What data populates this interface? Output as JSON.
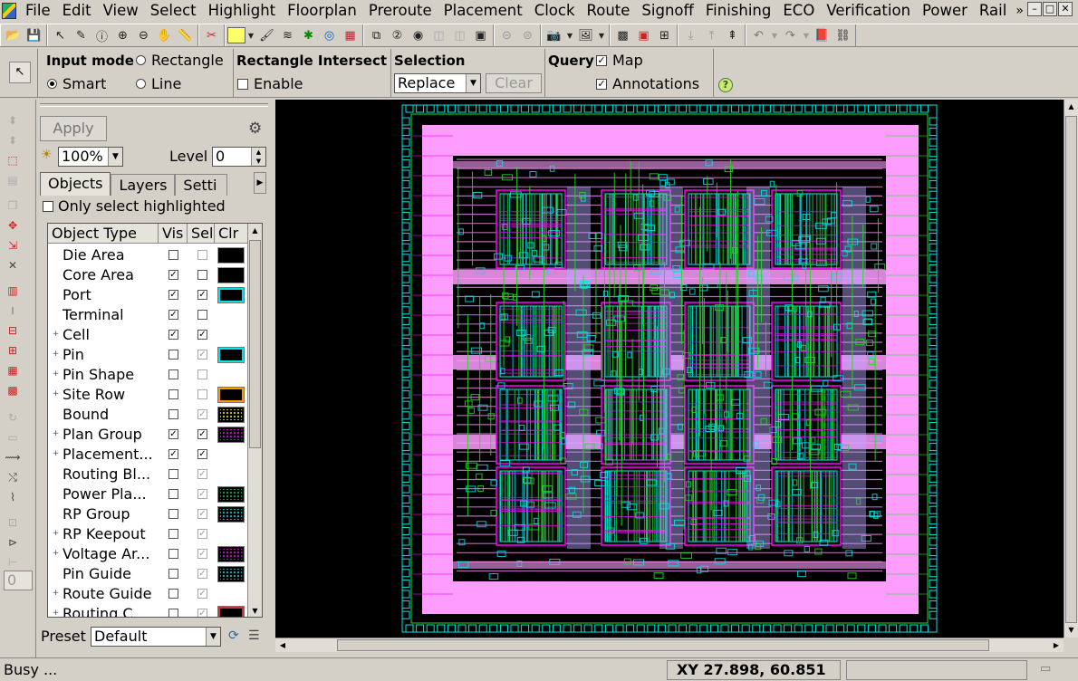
{
  "menu": [
    "File",
    "Edit",
    "View",
    "Select",
    "Highlight",
    "Floorplan",
    "Preroute",
    "Placement",
    "Clock",
    "Route",
    "Signoff",
    "Finishing",
    "ECO",
    "Verification",
    "Power",
    "Rail"
  ],
  "menu_overflow": "»",
  "window_controls": [
    "–",
    "□",
    "✕"
  ],
  "options": {
    "input_mode": {
      "label": "Input mode",
      "rectangle": "Rectangle",
      "smart": "Smart",
      "line": "Line",
      "selected": "Smart"
    },
    "rect_intersect": {
      "label": "Rectangle Intersect",
      "enable": "Enable",
      "enabled": false
    },
    "selection": {
      "label": "Selection",
      "value": "Replace",
      "clear_label": "Clear"
    },
    "query": {
      "label": "Query",
      "map": "Map",
      "map_checked": true,
      "annotations": "Annotations",
      "annotations_checked": true
    },
    "help_glyph": "?"
  },
  "panel": {
    "apply_label": "Apply",
    "brightness": "100%",
    "level_label": "Level",
    "level_value": "0",
    "tabs": [
      "Objects",
      "Layers",
      "Setti"
    ],
    "only_select_highlighted": "Only select highlighted",
    "columns": [
      "Object Type",
      "Vis",
      "Sel",
      "Clr"
    ],
    "rows": [
      {
        "name": "Die Area",
        "expandable": false,
        "vis": false,
        "sel": false,
        "color": "#000000",
        "pattern": "solid"
      },
      {
        "name": "Core Area",
        "expandable": false,
        "vis": true,
        "sel": false,
        "color": "#000000",
        "pattern": "solid"
      },
      {
        "name": "Port",
        "expandable": false,
        "vis": true,
        "sel": true,
        "color": "#00e5e5",
        "pattern": "outline"
      },
      {
        "name": "Terminal",
        "expandable": false,
        "vis": true,
        "sel": false,
        "color": "",
        "pattern": "none"
      },
      {
        "name": "Cell",
        "expandable": true,
        "vis": true,
        "sel": true,
        "color": "",
        "pattern": "none"
      },
      {
        "name": "Pin",
        "expandable": true,
        "vis": false,
        "sel": true,
        "color": "#00e5e5",
        "pattern": "outline"
      },
      {
        "name": "Pin Shape",
        "expandable": true,
        "vis": false,
        "sel": false,
        "color": "",
        "pattern": "none"
      },
      {
        "name": "Site Row",
        "expandable": true,
        "vis": false,
        "sel": false,
        "color": "#ff9900",
        "pattern": "outline"
      },
      {
        "name": "Bound",
        "expandable": false,
        "vis": false,
        "sel": true,
        "color": "#ffff00",
        "pattern": "dotted"
      },
      {
        "name": "Plan Group",
        "expandable": true,
        "vis": true,
        "sel": true,
        "color": "#ff00ff",
        "pattern": "dotted"
      },
      {
        "name": "Placement...",
        "expandable": true,
        "vis": true,
        "sel": true,
        "color": "",
        "pattern": "none"
      },
      {
        "name": "Routing Bl...",
        "expandable": false,
        "vis": false,
        "sel": true,
        "color": "",
        "pattern": "none"
      },
      {
        "name": "Power Pla...",
        "expandable": false,
        "vis": false,
        "sel": true,
        "color": "#00cc66",
        "pattern": "dotted"
      },
      {
        "name": "RP Group",
        "expandable": false,
        "vis": false,
        "sel": true,
        "color": "#00e5e5",
        "pattern": "dotted"
      },
      {
        "name": "RP Keepout",
        "expandable": true,
        "vis": false,
        "sel": true,
        "color": "",
        "pattern": "none"
      },
      {
        "name": "Voltage Ar...",
        "expandable": true,
        "vis": false,
        "sel": true,
        "color": "#ff00ff",
        "pattern": "dotted"
      },
      {
        "name": "Pin Guide",
        "expandable": false,
        "vis": false,
        "sel": true,
        "color": "#00e5e5",
        "pattern": "dotted"
      },
      {
        "name": "Route Guide",
        "expandable": true,
        "vis": false,
        "sel": true,
        "color": "",
        "pattern": "none"
      },
      {
        "name": "Routing C...",
        "expandable": true,
        "vis": false,
        "sel": true,
        "color": "#cc3333",
        "pattern": "outline"
      }
    ],
    "preset_label": "Preset",
    "preset_value": "Default",
    "left_tool_value": "0"
  },
  "status": {
    "message": "Busy ...",
    "coords": "XY 27.898, 60.851"
  },
  "colors": {
    "chrome": "#d4d0c8",
    "canvas": "#000000",
    "core_pink": "#ff9cff",
    "io_cyan": "#00e5e5",
    "net_green": "#22dd22",
    "macro_magenta": "#ff00ff"
  }
}
